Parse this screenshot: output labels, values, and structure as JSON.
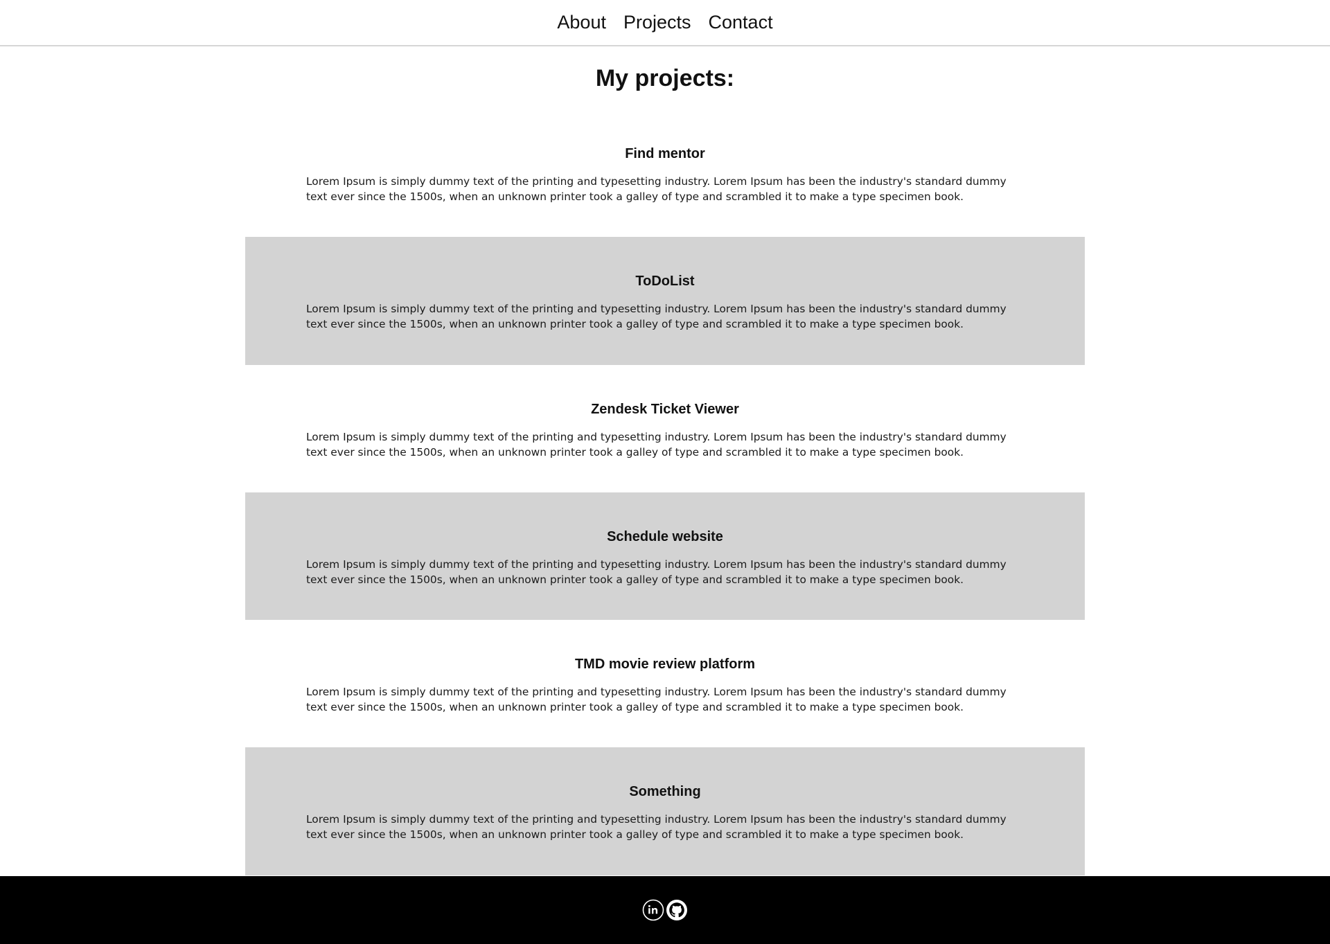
{
  "nav": {
    "items": [
      {
        "label": "About"
      },
      {
        "label": "Projects"
      },
      {
        "label": "Contact"
      }
    ]
  },
  "main": {
    "title": "My projects:",
    "projects": [
      {
        "title": "Find mentor",
        "description": "Lorem Ipsum is simply dummy text of the printing and typesetting industry. Lorem Ipsum has been the industry's standard dummy text ever since the 1500s, when an unknown printer took a galley of type and scrambled it to make a type specimen book.",
        "shaded": false
      },
      {
        "title": "ToDoList",
        "description": "Lorem Ipsum is simply dummy text of the printing and typesetting industry. Lorem Ipsum has been the industry's standard dummy text ever since the 1500s, when an unknown printer took a galley of type and scrambled it to make a type specimen book.",
        "shaded": true
      },
      {
        "title": "Zendesk Ticket Viewer",
        "description": "Lorem Ipsum is simply dummy text of the printing and typesetting industry. Lorem Ipsum has been the industry's standard dummy text ever since the 1500s, when an unknown printer took a galley of type and scrambled it to make a type specimen book.",
        "shaded": false
      },
      {
        "title": "Schedule website",
        "description": "Lorem Ipsum is simply dummy text of the printing and typesetting industry. Lorem Ipsum has been the industry's standard dummy text ever since the 1500s, when an unknown printer took a galley of type and scrambled it to make a type specimen book.",
        "shaded": true
      },
      {
        "title": "TMD movie review platform",
        "description": "Lorem Ipsum is simply dummy text of the printing and typesetting industry. Lorem Ipsum has been the industry's standard dummy text ever since the 1500s, when an unknown printer took a galley of type and scrambled it to make a type specimen book.",
        "shaded": false
      },
      {
        "title": "Something",
        "description": "Lorem Ipsum is simply dummy text of the printing and typesetting industry. Lorem Ipsum has been the industry's standard dummy text ever since the 1500s, when an unknown printer took a galley of type and scrambled it to make a type specimen book.",
        "shaded": true
      }
    ]
  },
  "footer": {
    "icons": [
      {
        "icon": "linkedin-icon"
      },
      {
        "icon": "github-icon"
      }
    ]
  },
  "colors": {
    "background": "#ffffff",
    "shaded_row": "#d3d3d3",
    "footer_background": "#000000",
    "nav_border": "#d6d6d6"
  }
}
